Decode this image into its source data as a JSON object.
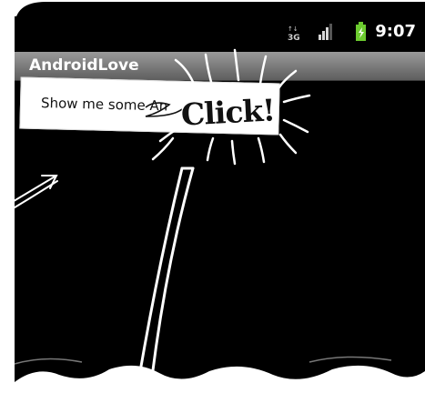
{
  "status_bar": {
    "time": "9:07",
    "network": "3G",
    "icons": [
      "network-3g-icon",
      "signal-bars-icon",
      "battery-charging-icon"
    ],
    "battery_color": "#6ccb2f"
  },
  "app": {
    "title": "AndroidLove",
    "button_label": "Show me some An"
  },
  "annotation": {
    "click_text": "Click!"
  }
}
